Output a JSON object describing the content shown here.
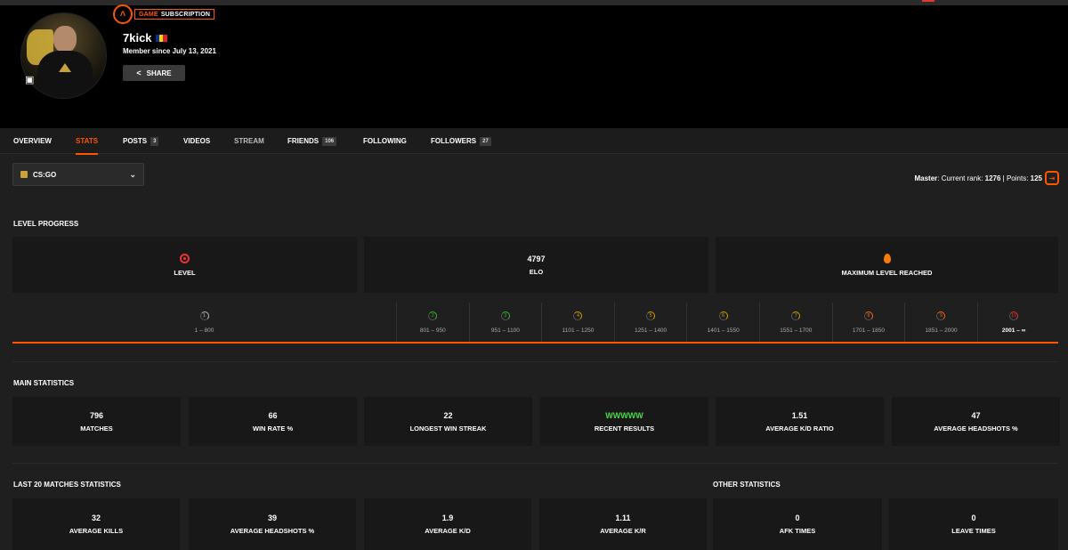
{
  "profile": {
    "subscription_label": "GAME SUBSCRIPTION",
    "subscription_prefix": "GAME",
    "subscription_rest": "SUBSCRIPTION",
    "username": "7kick",
    "member_since": "Member since July 13, 2021",
    "share_label": "SHARE"
  },
  "tabs": [
    {
      "label": "OVERVIEW"
    },
    {
      "label": "STATS"
    },
    {
      "label": "POSTS",
      "count": "3"
    },
    {
      "label": "VIDEOS"
    },
    {
      "label": "STREAM"
    },
    {
      "label": "FRIENDS",
      "count": "106"
    },
    {
      "label": "FOLLOWING"
    },
    {
      "label": "FOLLOWERS",
      "count": "27"
    }
  ],
  "game_select": {
    "value": "CS:GO"
  },
  "rank": {
    "label": "Master",
    "text": ": Current rank: ",
    "rank": "1276",
    "sep": " | Points: ",
    "points": "125"
  },
  "level_progress": {
    "title": "LEVEL PROGRESS",
    "level_label": "LEVEL",
    "elo_value": "4797",
    "elo_label": "ELO",
    "max_label": "MAXIMUM LEVEL REACHED",
    "levels": [
      {
        "n": "1",
        "range": "1 – 800",
        "color": "#bbbbbb"
      },
      {
        "n": "2",
        "range": "801 – 950",
        "color": "#2fbf2f"
      },
      {
        "n": "3",
        "range": "951 – 1100",
        "color": "#2fbf2f"
      },
      {
        "n": "4",
        "range": "1101 – 1250",
        "color": "#d6a400"
      },
      {
        "n": "5",
        "range": "1251 – 1400",
        "color": "#d6a400"
      },
      {
        "n": "6",
        "range": "1401 – 1550",
        "color": "#d6a400"
      },
      {
        "n": "7",
        "range": "1551 – 1700",
        "color": "#d6a400"
      },
      {
        "n": "8",
        "range": "1701 – 1850",
        "color": "#ff6a1a"
      },
      {
        "n": "9",
        "range": "1851 – 2000",
        "color": "#ff6a1a"
      },
      {
        "n": "10",
        "range": "2001 – ∞",
        "color": "#e33333"
      }
    ]
  },
  "main_stats": {
    "title": "MAIN STATISTICS",
    "items": [
      {
        "value": "796",
        "label": "MATCHES"
      },
      {
        "value": "66",
        "label": "WIN RATE %"
      },
      {
        "value": "22",
        "label": "LONGEST WIN STREAK"
      },
      {
        "value": "WWWWW",
        "label": "RECENT RESULTS"
      },
      {
        "value": "1.51",
        "label": "AVERAGE K/D RATIO"
      },
      {
        "value": "47",
        "label": "AVERAGE HEADSHOTS %"
      }
    ]
  },
  "last20": {
    "title": "LAST 20 MATCHES STATISTICS",
    "items": [
      {
        "value": "32",
        "label": "AVERAGE KILLS"
      },
      {
        "value": "39",
        "label": "AVERAGE HEADSHOTS %"
      },
      {
        "value": "1.9",
        "label": "AVERAGE K/D"
      },
      {
        "value": "1.11",
        "label": "AVERAGE K/R"
      }
    ]
  },
  "other": {
    "title": "OTHER STATISTICS",
    "items": [
      {
        "value": "0",
        "label": "AFK TIMES"
      },
      {
        "value": "0",
        "label": "LEAVE TIMES"
      }
    ]
  },
  "colors": {
    "accent": "#ff5500",
    "win": "#4ad94a"
  }
}
